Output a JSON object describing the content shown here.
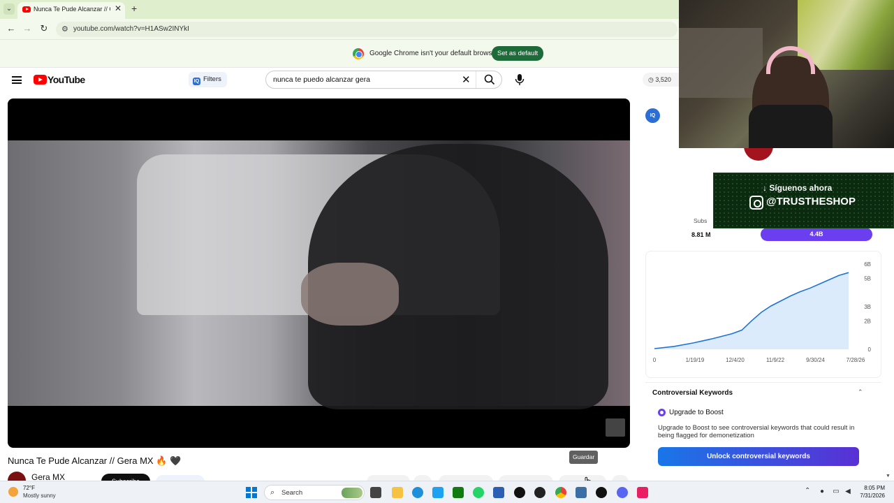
{
  "browser": {
    "tab_title": "Nunca Te Pude Alcanzar // Gera MX",
    "tab_close": "✕",
    "new_tab": "+",
    "url": "youtube.com/watch?v=H1ASw2INYkI",
    "nav_back": "←",
    "nav_forward": "→",
    "nav_reload": "↻",
    "infobar_text": "Google Chrome isn't your default browser",
    "infobar_button": "Set as default"
  },
  "youtube": {
    "logo_text": "YouTube",
    "filters_label": "Filters",
    "filters_badge": "IQ",
    "search_query": "nunca te puedo alcanzar gera",
    "clear_symbol": "✕",
    "count_badge": "3,520",
    "video_title": "Nunca Te Pude Alcanzar // Gera MX 🔥 🖤",
    "channel_name": "Gera MX",
    "subscribe_label": "Subscribe",
    "tooltip": "Guardar"
  },
  "sidebar": {
    "iq_badge": "IQ",
    "subs_label": "Subs",
    "subs_value": "8.81 M",
    "views_value": "4.4B",
    "chart_data": {
      "type": "area",
      "x": [
        "0",
        "1/19/19",
        "12/4/20",
        "11/9/22",
        "9/30/24",
        "7/28/26"
      ],
      "y_ticks": [
        "0",
        "2B",
        "3B",
        "5B",
        "6B"
      ],
      "ylim": [
        0,
        6
      ],
      "series": [
        {
          "values": [
            [
              0,
              0.05
            ],
            [
              0.1,
              0.2
            ],
            [
              0.2,
              0.45
            ],
            [
              0.3,
              0.75
            ],
            [
              0.4,
              1.1
            ],
            [
              0.45,
              1.35
            ],
            [
              0.5,
              2.0
            ],
            [
              0.55,
              2.6
            ],
            [
              0.6,
              3.05
            ],
            [
              0.65,
              3.4
            ],
            [
              0.7,
              3.75
            ],
            [
              0.75,
              4.05
            ],
            [
              0.8,
              4.3
            ],
            [
              0.85,
              4.6
            ],
            [
              0.9,
              4.9
            ],
            [
              0.95,
              5.2
            ],
            [
              1.0,
              5.4
            ]
          ]
        }
      ],
      "line_color": "#1e73d9",
      "fill_color": "#dcebfb"
    },
    "keywords_title": "Controversial Keywords",
    "keywords_chevron": "⌃",
    "boost_title": "Upgrade to Boost",
    "boost_desc": "Upgrade to Boost to see controversial keywords that could result in being flagged for demonetization",
    "unlock_button": "Unlock controversial keywords"
  },
  "promo": {
    "line1": "↓ Síguenos ahora",
    "handle": "@TRUSTHESHOP"
  },
  "taskbar": {
    "weather_temp": "72°F",
    "weather_desc": "Mostly sunny",
    "search_placeholder": "Search",
    "search_glyph": "⌕",
    "time": "8:05 PM",
    "date": "7/31/2026",
    "tray_chevron": "⌃"
  }
}
